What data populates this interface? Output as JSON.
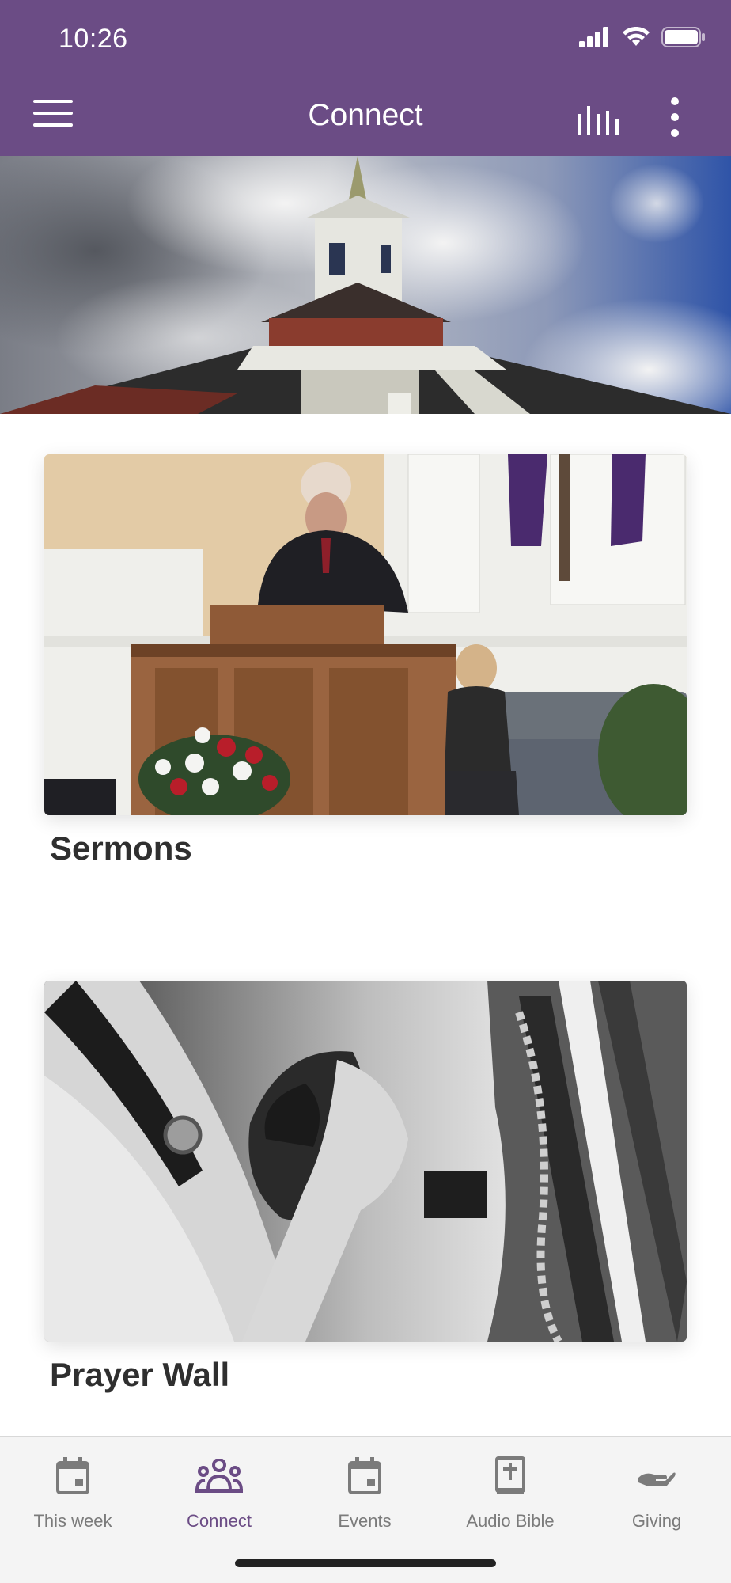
{
  "status_bar": {
    "time": "10:26"
  },
  "app_bar": {
    "title": "Connect"
  },
  "cards": [
    {
      "title": "Sermons"
    },
    {
      "title": "Prayer Wall"
    }
  ],
  "bottom_nav": {
    "items": [
      {
        "label": "This week",
        "icon": "calendar-icon",
        "active": false
      },
      {
        "label": "Connect",
        "icon": "people-icon",
        "active": true
      },
      {
        "label": "Events",
        "icon": "calendar-icon",
        "active": false
      },
      {
        "label": "Audio Bible",
        "icon": "bible-icon",
        "active": false
      },
      {
        "label": "Giving",
        "icon": "giving-hand-icon",
        "active": false
      }
    ]
  },
  "colors": {
    "brand_purple": "#6b4c85",
    "nav_inactive": "#7b7b7b",
    "nav_background": "#f4f4f4"
  }
}
